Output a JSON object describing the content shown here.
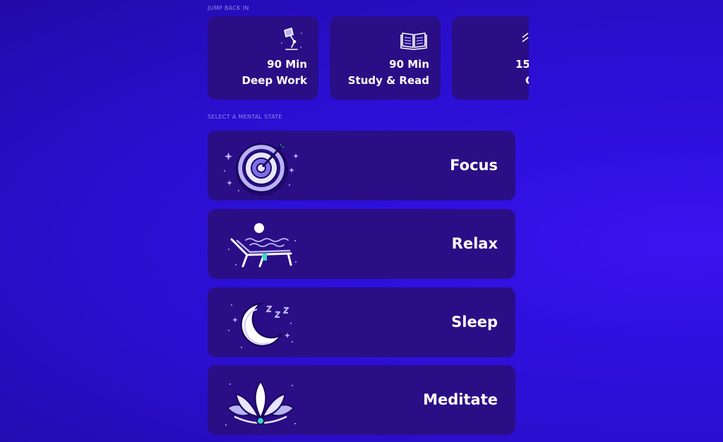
{
  "jump_back": {
    "label": "JUMP BACK IN",
    "cards": [
      {
        "duration": "90 Min",
        "title": "Deep Work",
        "icon": "desk-lamp-icon"
      },
      {
        "duration": "90 Min",
        "title": "Study & Read",
        "icon": "open-book-icon"
      },
      {
        "duration": "15",
        "title": "C",
        "icon": "partial-icon"
      }
    ]
  },
  "mental_state": {
    "label": "SELECT A MENTAL STATE",
    "options": [
      {
        "label": "Focus",
        "icon": "target-icon"
      },
      {
        "label": "Relax",
        "icon": "lounge-chair-icon"
      },
      {
        "label": "Sleep",
        "icon": "moon-icon"
      },
      {
        "label": "Meditate",
        "icon": "lotus-icon"
      }
    ]
  },
  "colors": {
    "background": "#2f10de",
    "card": "#2a0e86",
    "accent_light": "#b9b3f5",
    "accent_teal": "#3ad6c6"
  }
}
